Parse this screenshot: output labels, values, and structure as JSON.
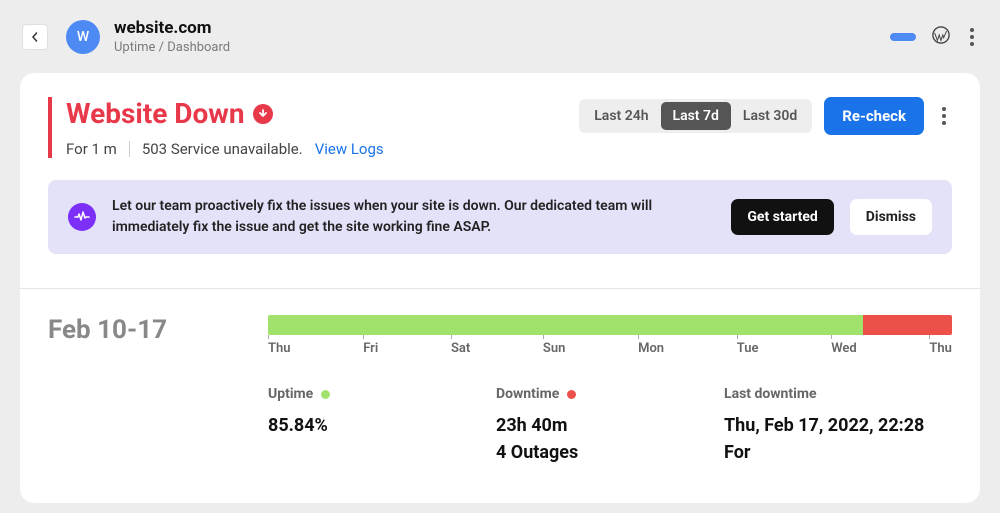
{
  "header": {
    "avatar_letter": "W",
    "site_title": "website.com",
    "breadcrumb": "Uptime / Dashboard"
  },
  "status": {
    "title": "Website Down",
    "duration": "For 1 m",
    "error": "503 Service unavailable.",
    "view_logs_label": "View Logs"
  },
  "time_ranges": {
    "items": [
      {
        "label": "Last 24h",
        "active": false
      },
      {
        "label": "Last 7d",
        "active": true
      },
      {
        "label": "Last 30d",
        "active": false
      }
    ]
  },
  "recheck_label": "Re-check",
  "banner": {
    "text": "Let our team proactively fix the issues when your site is down. Our dedicated team will immediately fix the issue and get the site working fine ASAP.",
    "get_started_label": "Get started",
    "dismiss_label": "Dismiss"
  },
  "date_range": "Feb 10-17",
  "timeline": {
    "segments": [
      {
        "color": "green",
        "width": 87
      },
      {
        "color": "red",
        "width": 13
      }
    ],
    "ticks": [
      "Thu",
      "Fri",
      "Sat",
      "Sun",
      "Mon",
      "Tue",
      "Wed",
      "Thu"
    ]
  },
  "stats": {
    "uptime": {
      "label": "Uptime",
      "value": "85.84%"
    },
    "downtime": {
      "label": "Downtime",
      "value_line1": "23h 40m",
      "value_line2": "4 Outages"
    },
    "last_downtime": {
      "label": "Last downtime",
      "value_line1": "Thu, Feb 17, 2022, 22:28",
      "value_line2": "For"
    }
  }
}
